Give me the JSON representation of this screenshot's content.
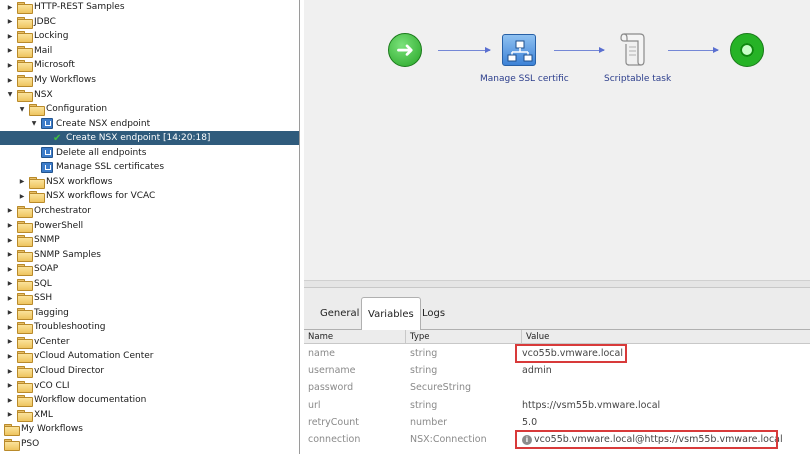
{
  "tree": {
    "items": [
      {
        "label": "HTTP-REST Samples",
        "indent": 0,
        "arrow": "right",
        "icon": "folder"
      },
      {
        "label": "JDBC",
        "indent": 0,
        "arrow": "right",
        "icon": "folder"
      },
      {
        "label": "Locking",
        "indent": 0,
        "arrow": "right",
        "icon": "folder"
      },
      {
        "label": "Mail",
        "indent": 0,
        "arrow": "right",
        "icon": "folder"
      },
      {
        "label": "Microsoft",
        "indent": 0,
        "arrow": "right",
        "icon": "folder"
      },
      {
        "label": "My Workflows",
        "indent": 0,
        "arrow": "right",
        "icon": "folder"
      },
      {
        "label": "NSX",
        "indent": 0,
        "arrow": "down",
        "icon": "folder"
      },
      {
        "label": "Configuration",
        "indent": 1,
        "arrow": "down",
        "icon": "folder"
      },
      {
        "label": "Create NSX endpoint",
        "indent": 2,
        "arrow": "down",
        "icon": "workflow"
      },
      {
        "label": "Create NSX endpoint [14:20:18]",
        "indent": 3,
        "arrow": "none",
        "icon": "check",
        "selected": true
      },
      {
        "label": "Delete all endpoints",
        "indent": 2,
        "arrow": "none",
        "icon": "workflow"
      },
      {
        "label": "Manage SSL certificates",
        "indent": 2,
        "arrow": "none",
        "icon": "workflow"
      },
      {
        "label": "NSX workflows",
        "indent": 1,
        "arrow": "right",
        "icon": "folder"
      },
      {
        "label": "NSX workflows for VCAC",
        "indent": 1,
        "arrow": "right",
        "icon": "folder"
      },
      {
        "label": "Orchestrator",
        "indent": 0,
        "arrow": "right",
        "icon": "folder"
      },
      {
        "label": "PowerShell",
        "indent": 0,
        "arrow": "right",
        "icon": "folder"
      },
      {
        "label": "SNMP",
        "indent": 0,
        "arrow": "right",
        "icon": "folder"
      },
      {
        "label": "SNMP Samples",
        "indent": 0,
        "arrow": "right",
        "icon": "folder"
      },
      {
        "label": "SOAP",
        "indent": 0,
        "arrow": "right",
        "icon": "folder"
      },
      {
        "label": "SQL",
        "indent": 0,
        "arrow": "right",
        "icon": "folder"
      },
      {
        "label": "SSH",
        "indent": 0,
        "arrow": "right",
        "icon": "folder"
      },
      {
        "label": "Tagging",
        "indent": 0,
        "arrow": "right",
        "icon": "folder"
      },
      {
        "label": "Troubleshooting",
        "indent": 0,
        "arrow": "right",
        "icon": "folder"
      },
      {
        "label": "vCenter",
        "indent": 0,
        "arrow": "right",
        "icon": "folder"
      },
      {
        "label": "vCloud Automation Center",
        "indent": 0,
        "arrow": "right",
        "icon": "folder"
      },
      {
        "label": "vCloud Director",
        "indent": 0,
        "arrow": "right",
        "icon": "folder"
      },
      {
        "label": "vCO CLI",
        "indent": 0,
        "arrow": "right",
        "icon": "folder"
      },
      {
        "label": "Workflow documentation",
        "indent": 0,
        "arrow": "right",
        "icon": "folder"
      },
      {
        "label": "XML",
        "indent": 0,
        "arrow": "right",
        "icon": "folder"
      },
      {
        "label": "My Workflows",
        "indent": -1,
        "arrow": "none",
        "icon": "folder"
      },
      {
        "label": "PSO",
        "indent": -1,
        "arrow": "none",
        "icon": "folder"
      }
    ]
  },
  "schema": {
    "manage_ssl_caption": "Manage SSL certific",
    "scriptable_caption": "Scriptable task",
    "start_icon": "arrow-right-icon",
    "end_icon": "end-icon"
  },
  "tabs": {
    "general": "General",
    "variables": "Variables",
    "logs": "Logs",
    "active": "Variables"
  },
  "variables": {
    "headers": {
      "name": "Name",
      "type": "Type",
      "value": "Value"
    },
    "rows": [
      {
        "name": "name",
        "type": "string",
        "value": "vco55b.vmware.local",
        "highlight": true
      },
      {
        "name": "username",
        "type": "string",
        "value": "admin"
      },
      {
        "name": "password",
        "type": "SecureString",
        "value": ""
      },
      {
        "name": "url",
        "type": "string",
        "value": "https://vsm55b.vmware.local"
      },
      {
        "name": "retryCount",
        "type": "number",
        "value": "5.0"
      },
      {
        "name": "connection",
        "type": "NSX:Connection",
        "value": "vco55b.vmware.local@https://vsm55b.vmware.local",
        "highlight": true,
        "info_icon": true
      }
    ]
  },
  "colors": {
    "selection": "#2f5b7c",
    "highlight": "#d83a3a",
    "connector": "#5a6fd0"
  }
}
